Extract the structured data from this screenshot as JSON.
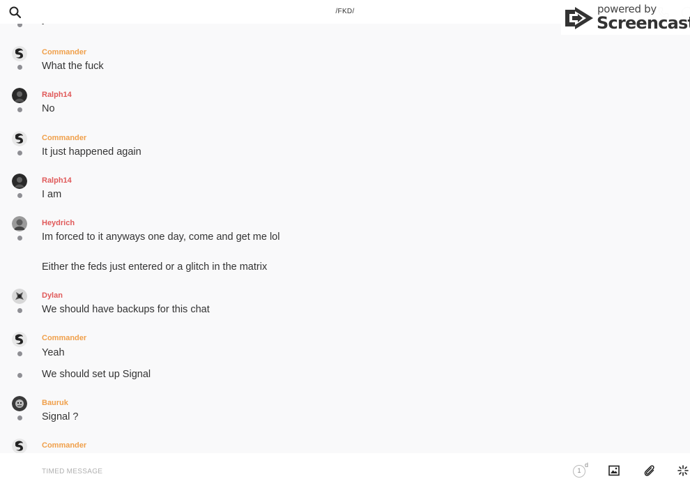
{
  "header": {
    "title": "/FKD/",
    "search_icon": "search-icon",
    "call_icon": "phone-icon",
    "info_icon": "info-icon"
  },
  "watermark": {
    "line1": "powered by",
    "line2": "Screencastify"
  },
  "colors": {
    "commander": "#f0a04b",
    "ralph": "#e05a5a",
    "heydrich": "#e05a5a",
    "dylan": "#e05a5a",
    "bauruk": "#f0a04b",
    "dot": "#8f8f94"
  },
  "messages": [
    {
      "author": "",
      "text": "yeah"
    },
    {
      "author": "Commander",
      "text": "What the fuck"
    },
    {
      "author": "Ralph14",
      "text": "No"
    },
    {
      "author": "Commander",
      "text": "It just happened again"
    },
    {
      "author": "Ralph14",
      "text": "I am"
    },
    {
      "author": "Heydrich",
      "text": "Im forced to it anyways one day, come and get me lol",
      "text2": "Either the feds just entered or a glitch in the matrix"
    },
    {
      "author": "Dylan",
      "text": "We should have backups for this chat"
    },
    {
      "author": "Commander",
      "text": "Yeah",
      "text2": "We should set up Signal"
    },
    {
      "author": "Bauruk",
      "text": "Signal ?"
    },
    {
      "author": "Commander",
      "text": ""
    }
  ],
  "composer": {
    "placeholder": "TIMED MESSAGE",
    "timer_value": "1",
    "timer_unit": "d",
    "image_icon": "image-icon",
    "attach_icon": "paperclip-icon",
    "more_icon": "sparkle-icon"
  }
}
